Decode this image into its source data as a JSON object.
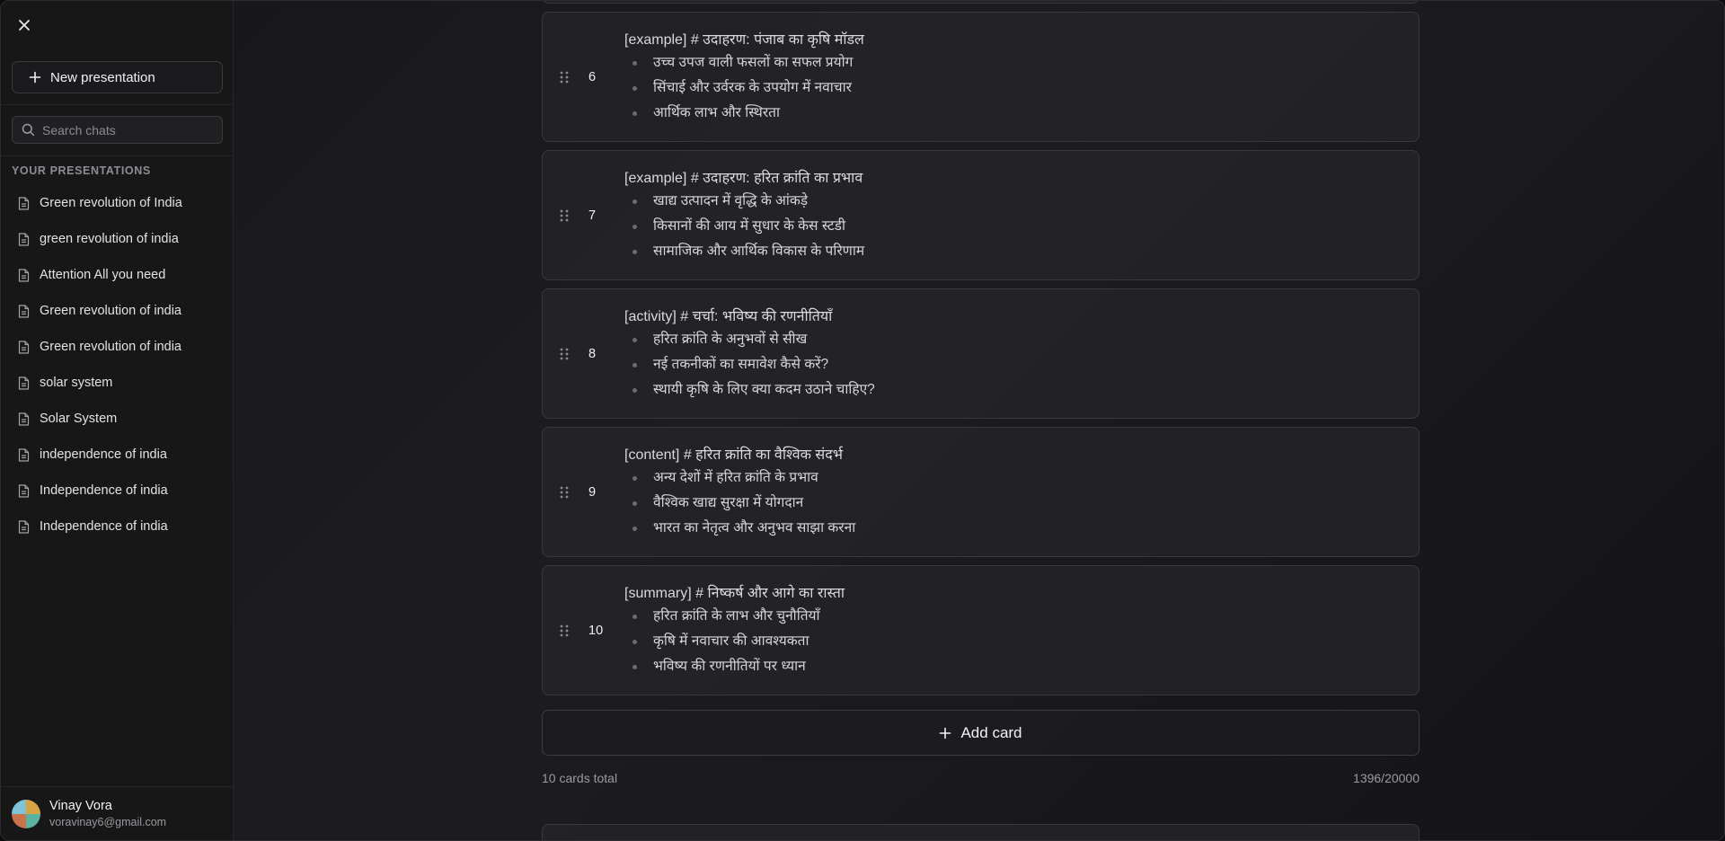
{
  "sidebar": {
    "new_presentation_label": "New presentation",
    "search_placeholder": "Search chats",
    "section_title": "YOUR PRESENTATIONS",
    "presentations": [
      "Green revolution of India",
      "green revolution of india",
      "Attention All you need",
      "Green revolution of india",
      "Green revolution of india",
      "solar system",
      "Solar System",
      "independence of india",
      "Independence of india",
      "Independence of india"
    ],
    "user": {
      "name": "Vinay Vora",
      "email": "voravinay6@gmail.com"
    }
  },
  "cards": [
    {
      "number": "6",
      "title": "[example] # उदाहरण: पंजाब का कृषि मॉडल",
      "bullets": [
        "उच्च उपज वाली फसलों का सफल प्रयोग",
        "सिंचाई और उर्वरक के उपयोग में नवाचार",
        "आर्थिक लाभ और स्थिरता"
      ]
    },
    {
      "number": "7",
      "title": "[example] # उदाहरण: हरित क्रांति का प्रभाव",
      "bullets": [
        "खाद्य उत्पादन में वृद्धि के आंकड़े",
        "किसानों की आय में सुधार के केस स्टडी",
        "सामाजिक और आर्थिक विकास के परिणाम"
      ]
    },
    {
      "number": "8",
      "title": "[activity] # चर्चा: भविष्य की रणनीतियाँ",
      "bullets": [
        "हरित क्रांति के अनुभवों से सीख",
        "नई तकनीकों का समावेश कैसे करें?",
        "स्थायी कृषि के लिए क्या कदम उठाने चाहिए?"
      ]
    },
    {
      "number": "9",
      "title": "[content] # हरित क्रांति का वैश्विक संदर्भ",
      "bullets": [
        "अन्य देशों में हरित क्रांति के प्रभाव",
        "वैश्विक खाद्य सुरक्षा में योगदान",
        "भारत का नेतृत्व और अनुभव साझा करना"
      ]
    },
    {
      "number": "10",
      "title": "[summary] # निष्कर्ष और आगे का रास्ता",
      "bullets": [
        "हरित क्रांति के लाभ और चुनौतियाँ",
        "कृषि में नवाचार की आवश्यकता",
        "भविष्य की रणनीतियों पर ध्यान"
      ]
    }
  ],
  "add_card_label": "Add card",
  "footer": {
    "total": "10 cards total",
    "char_count": "1396/20000"
  }
}
